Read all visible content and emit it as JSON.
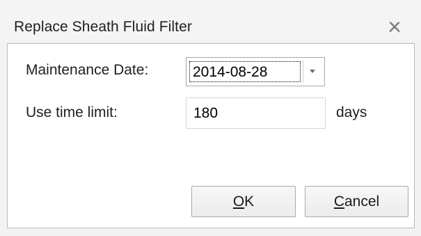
{
  "dialog": {
    "title": "Replace Sheath Fluid Filter",
    "close_icon": "close-icon"
  },
  "form": {
    "maintenance_date_label": "Maintenance Date:",
    "maintenance_date_value": "2014-08-28",
    "dropdown_icon": "chevron-down-icon",
    "use_time_limit_label": "Use time limit:",
    "use_time_limit_value": "180",
    "unit_label": "days"
  },
  "buttons": {
    "ok_mnemonic": "O",
    "ok_rest": "K",
    "cancel_mnemonic": "C",
    "cancel_rest": "ancel"
  }
}
